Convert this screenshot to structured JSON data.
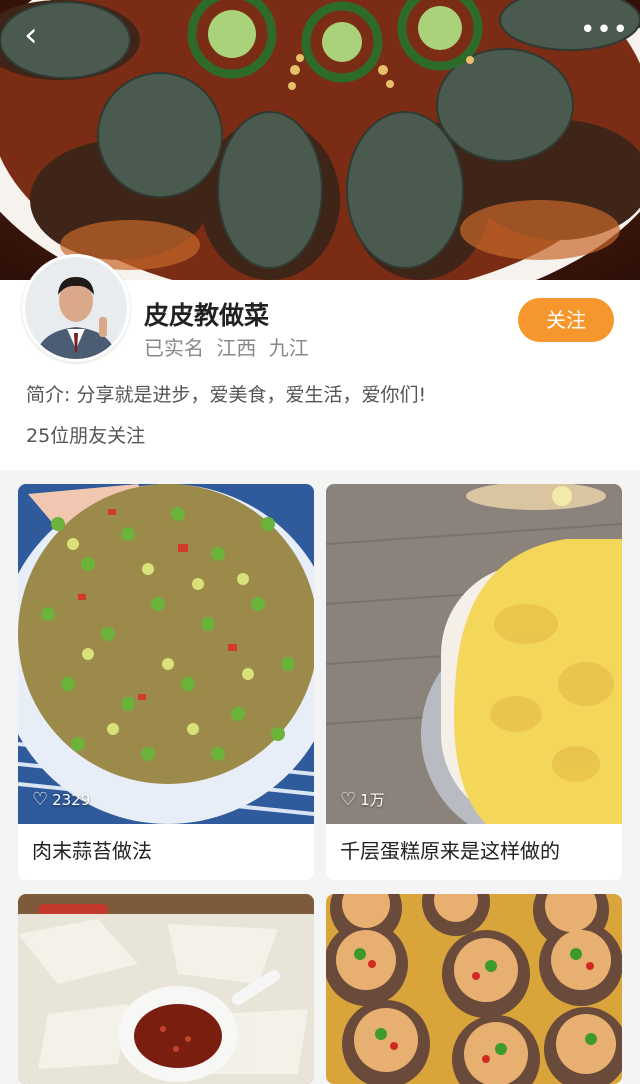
{
  "nav": {
    "back_icon": "chevron-left-icon",
    "more_icon": "more-dots-icon"
  },
  "profile": {
    "name": "皮皮教做菜",
    "meta": "已实名 江西 九江",
    "follow_label": "关注",
    "intro": "简介: 分享就是进步，爱美食，爱生活，爱你们!",
    "fans": "25位朋友关注"
  },
  "colors": {
    "accent": "#f5972c"
  },
  "feed": [
    {
      "title": "肉末蒜苔做法",
      "likes": "2329"
    },
    {
      "title": "千层蛋糕原来是这样做的",
      "likes": "1万"
    },
    {
      "title": "",
      "likes": ""
    },
    {
      "title": "",
      "likes": ""
    }
  ]
}
